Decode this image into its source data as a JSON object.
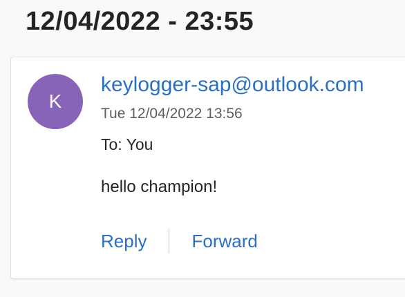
{
  "message": {
    "subject": "12/04/2022 - 23:55",
    "avatar_initial": "K",
    "avatar_color": "#8764b8",
    "sender": "keylogger-sap@outlook.com",
    "timestamp": "Tue 12/04/2022 13:56",
    "to": "To: You",
    "body": "hello champion!"
  },
  "actions": {
    "reply_label": "Reply",
    "forward_label": "Forward"
  },
  "colors": {
    "link": "#2b6fc2",
    "text": "#252423",
    "secondary_text": "#605e5c"
  }
}
